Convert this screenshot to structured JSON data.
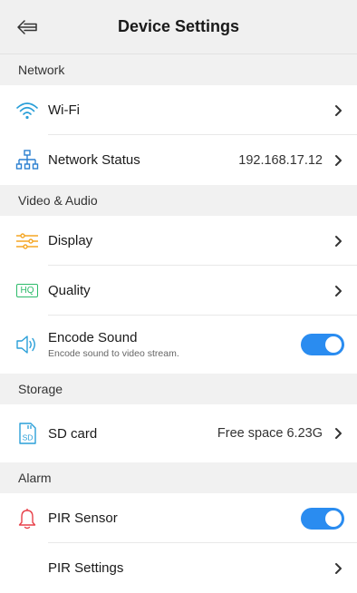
{
  "header": {
    "title": "Device Settings"
  },
  "sections": {
    "network": {
      "title": "Network",
      "wifi": {
        "label": "Wi-Fi"
      },
      "status": {
        "label": "Network Status",
        "value": "192.168.17.12"
      }
    },
    "video": {
      "title": "Video & Audio",
      "display": {
        "label": "Display"
      },
      "quality": {
        "label": "Quality",
        "icon_text": "HQ"
      },
      "encode": {
        "label": "Encode Sound",
        "sublabel": "Encode sound to video stream.",
        "enabled": true
      }
    },
    "storage": {
      "title": "Storage",
      "sd": {
        "label": "SD card",
        "value": "Free space 6.23G",
        "icon_text": "SD"
      }
    },
    "alarm": {
      "title": "Alarm",
      "pir": {
        "label": "PIR Sensor",
        "enabled": true
      },
      "pir_settings": {
        "label": "PIR Settings"
      }
    }
  },
  "colors": {
    "wifi_icon": "#2a9fd8",
    "network_icon": "#2a7fd0",
    "display_icon": "#f5a623",
    "quality_icon": "#2dbb6a",
    "encode_icon": "#2a9fd8",
    "sd_icon": "#2a9fd8",
    "pir_icon": "#e8414a",
    "toggle_on": "#2a8cf0"
  }
}
